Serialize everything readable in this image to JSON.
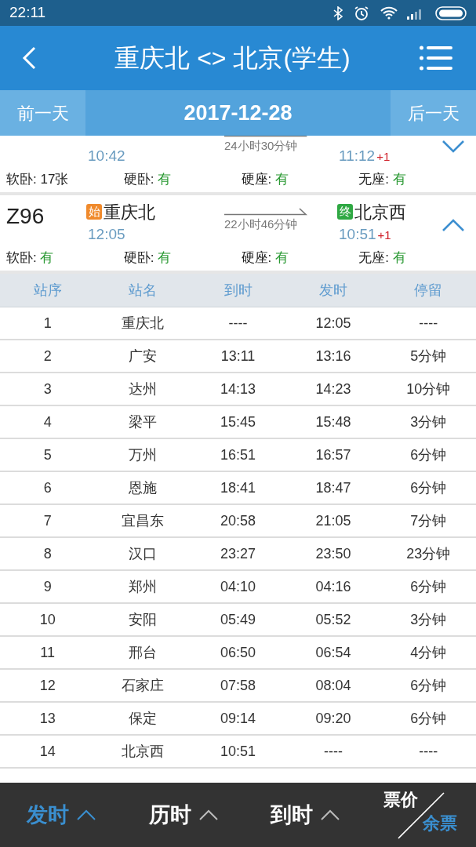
{
  "status_bar": {
    "time": "22:11"
  },
  "header": {
    "title": "重庆北 <> 北京(学生)"
  },
  "date_bar": {
    "prev": "前一天",
    "date": "2017-12-28",
    "next": "后一天"
  },
  "trains": [
    {
      "from_time": "10:42",
      "duration": "24小时30分钟",
      "to_time": "11:12",
      "day_offset": "+1",
      "expanded": false,
      "seats": [
        {
          "label": "软卧:",
          "value": "17张",
          "plenty": false
        },
        {
          "label": "硬卧:",
          "value": "有",
          "plenty": true
        },
        {
          "label": "硬座:",
          "value": "有",
          "plenty": true
        },
        {
          "label": "无座:",
          "value": "有",
          "plenty": true
        }
      ]
    },
    {
      "number": "Z96",
      "from_tag": "始",
      "from": "重庆北",
      "from_time": "12:05",
      "duration": "22小时46分钟",
      "to_tag": "终",
      "to": "北京西",
      "to_time": "10:51",
      "day_offset": "+1",
      "expanded": true,
      "seats": [
        {
          "label": "软卧:",
          "value": "有",
          "plenty": true
        },
        {
          "label": "硬卧:",
          "value": "有",
          "plenty": true
        },
        {
          "label": "硬座:",
          "value": "有",
          "plenty": true
        },
        {
          "label": "无座:",
          "value": "有",
          "plenty": true
        }
      ]
    }
  ],
  "stops_table": {
    "columns": [
      "站序",
      "站名",
      "到时",
      "发时",
      "停留"
    ],
    "rows": [
      [
        "1",
        "重庆北",
        "----",
        "12:05",
        "----"
      ],
      [
        "2",
        "广安",
        "13:11",
        "13:16",
        "5分钟"
      ],
      [
        "3",
        "达州",
        "14:13",
        "14:23",
        "10分钟"
      ],
      [
        "4",
        "梁平",
        "15:45",
        "15:48",
        "3分钟"
      ],
      [
        "5",
        "万州",
        "16:51",
        "16:57",
        "6分钟"
      ],
      [
        "6",
        "恩施",
        "18:41",
        "18:47",
        "6分钟"
      ],
      [
        "7",
        "宜昌东",
        "20:58",
        "21:05",
        "7分钟"
      ],
      [
        "8",
        "汉口",
        "23:27",
        "23:50",
        "23分钟"
      ],
      [
        "9",
        "郑州",
        "04:10",
        "04:16",
        "6分钟"
      ],
      [
        "10",
        "安阳",
        "05:49",
        "05:52",
        "3分钟"
      ],
      [
        "11",
        "邢台",
        "06:50",
        "06:54",
        "4分钟"
      ],
      [
        "12",
        "石家庄",
        "07:58",
        "08:04",
        "6分钟"
      ],
      [
        "13",
        "保定",
        "09:14",
        "09:20",
        "6分钟"
      ],
      [
        "14",
        "北京西",
        "10:51",
        "----",
        "----"
      ]
    ]
  },
  "sort_bar": [
    {
      "kind": "sort",
      "label": "发时",
      "selected": true
    },
    {
      "kind": "sort",
      "label": "历时",
      "selected": false
    },
    {
      "kind": "sort",
      "label": "到时",
      "selected": false
    },
    {
      "kind": "split",
      "parts": [
        {
          "label": "票价",
          "selected": false
        },
        {
          "label": "余票",
          "selected": true
        }
      ]
    }
  ]
}
